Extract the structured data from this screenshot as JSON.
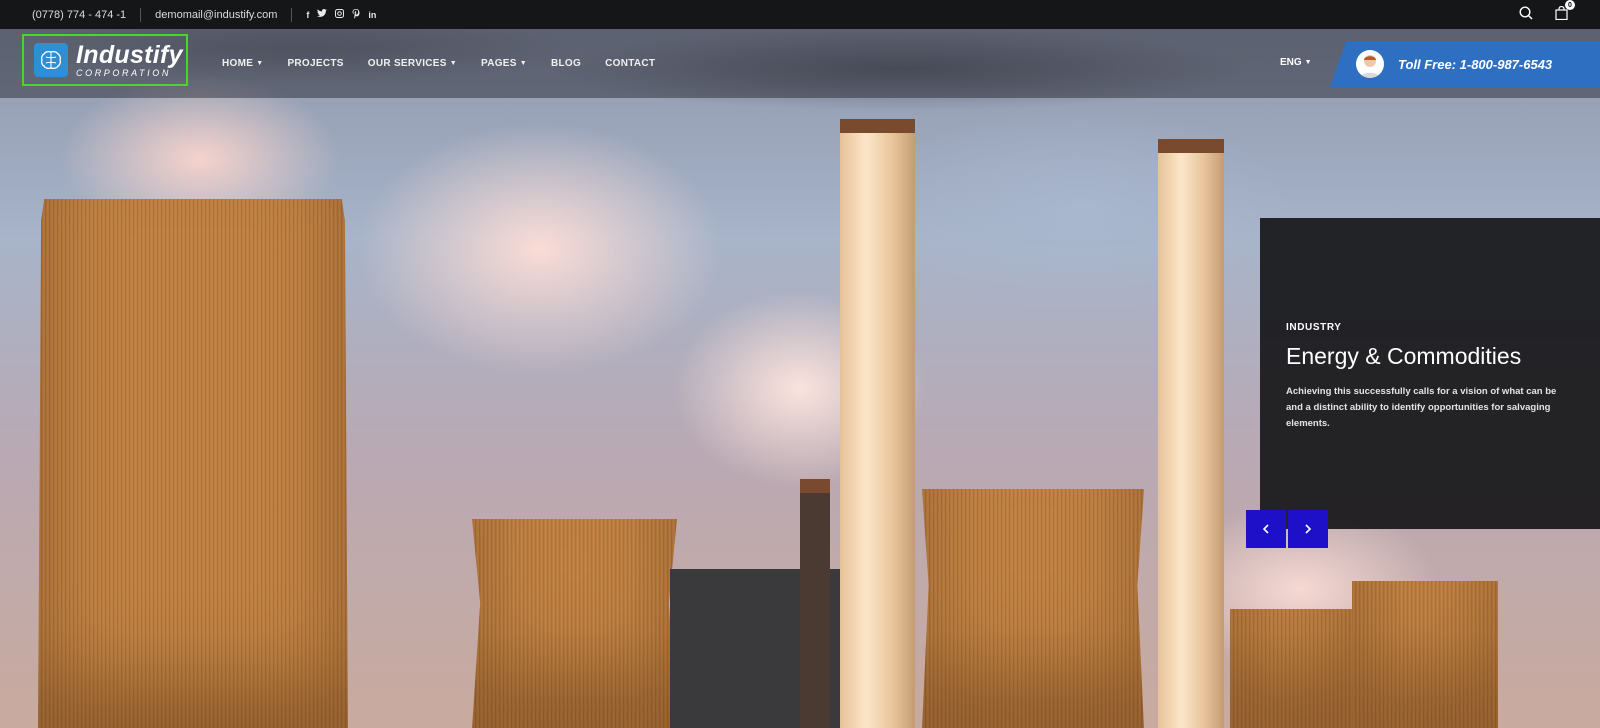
{
  "topbar": {
    "phone": "(0778) 774 - 474 -1",
    "email": "demomail@industify.com",
    "socials": [
      "f",
      "t",
      "ig",
      "p",
      "in"
    ],
    "cart_count": "0"
  },
  "header": {
    "logo_name": "Industify",
    "logo_sub": "CORPORATION",
    "nav": [
      {
        "label": "HOME",
        "dropdown": true
      },
      {
        "label": "PROJECTS",
        "dropdown": false
      },
      {
        "label": "OUR SERVICES",
        "dropdown": true
      },
      {
        "label": "PAGES",
        "dropdown": true
      },
      {
        "label": "BLOG",
        "dropdown": false
      },
      {
        "label": "CONTACT",
        "dropdown": false
      }
    ],
    "language": "ENG",
    "toll_free": "Toll Free: 1-800-987-6543"
  },
  "slide": {
    "kicker": "INDUSTRY",
    "title": "Energy & Commodities",
    "description": "Achieving this successfully calls for a vision of what can be and a distinct ability to identify opportunities for salvaging elements."
  },
  "colors": {
    "accent_blue": "#2e6fc2",
    "arrow_blue": "#1e10c9",
    "logo_outline": "#4cd32c"
  }
}
